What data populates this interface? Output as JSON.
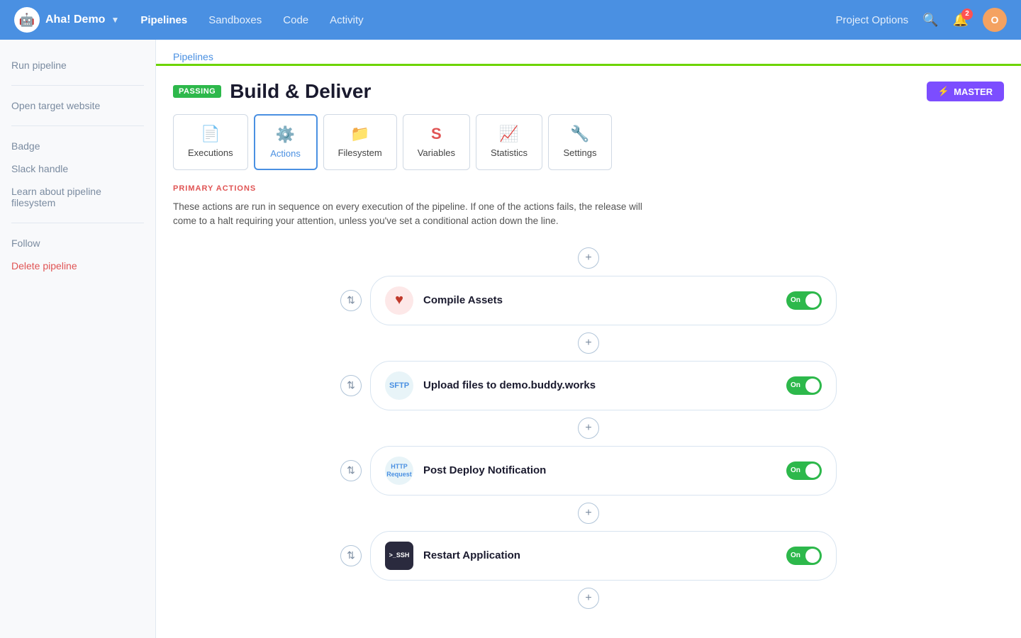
{
  "nav": {
    "logo_text": "Aha! Demo",
    "logo_icon": "🤖",
    "links": [
      {
        "label": "Pipelines",
        "active": true
      },
      {
        "label": "Sandboxes",
        "active": false
      },
      {
        "label": "Code",
        "active": false
      },
      {
        "label": "Activity",
        "active": false
      }
    ],
    "project_options": "Project Options",
    "bell_count": "2",
    "avatar_letter": "O"
  },
  "sidebar": {
    "items": [
      {
        "label": "Run pipeline",
        "type": "normal"
      },
      {
        "label": "Open target website",
        "type": "normal"
      },
      {
        "label": "Badge",
        "type": "normal"
      },
      {
        "label": "Slack handle",
        "type": "normal"
      },
      {
        "label": "Learn about pipeline filesystem",
        "type": "normal"
      },
      {
        "label": "Follow",
        "type": "normal"
      },
      {
        "label": "Delete pipeline",
        "type": "danger"
      }
    ]
  },
  "breadcrumb": {
    "label": "Pipelines"
  },
  "pipeline": {
    "passing_label": "PASSING",
    "title": "Build & Deliver",
    "master_label": "MASTER"
  },
  "tabs": [
    {
      "label": "Executions",
      "icon": "📄",
      "active": false
    },
    {
      "label": "Actions",
      "icon": "⚙️",
      "active": true
    },
    {
      "label": "Filesystem",
      "icon": "📁",
      "active": false
    },
    {
      "label": "Variables",
      "icon": "🅢",
      "active": false
    },
    {
      "label": "Statistics",
      "icon": "📈",
      "active": false
    },
    {
      "label": "Settings",
      "icon": "🔧",
      "active": false
    }
  ],
  "primary_actions": {
    "section_label": "PRIMARY ACTIONS",
    "description": "These actions are run in sequence on every execution of the pipeline. If one of the actions fails, the release will come to a halt requiring your attention, unless you've set a conditional action down the line."
  },
  "actions": [
    {
      "name": "Compile Assets",
      "icon_type": "ruby",
      "icon_text": "♥",
      "toggle": "On"
    },
    {
      "name": "Upload files to demo.buddy.works",
      "icon_type": "sftp",
      "icon_text": "SFTP",
      "toggle": "On"
    },
    {
      "name": "Post Deploy Notification",
      "icon_type": "http",
      "icon_text": "HTTP\nRequest",
      "toggle": "On"
    },
    {
      "name": "Restart Application",
      "icon_type": "ssh",
      "icon_text": ">_SSH",
      "toggle": "On"
    }
  ]
}
